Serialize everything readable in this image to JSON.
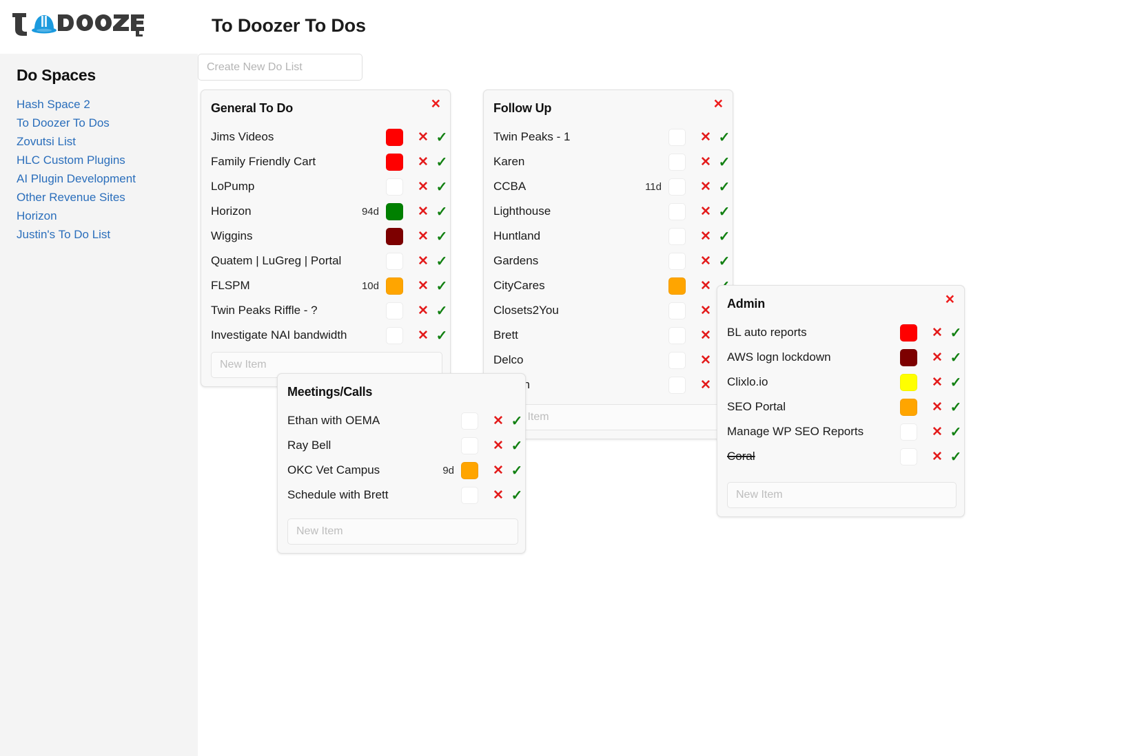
{
  "app": {
    "logo_text": "TO DOOZER",
    "logo_hat_color": "#1b9ade",
    "logo_word_color": "#333333",
    "page_title": "To Doozer To Dos"
  },
  "sidebar": {
    "title": "Do Spaces",
    "items": [
      {
        "label": "Hash Space 2"
      },
      {
        "label": "To Doozer To Dos"
      },
      {
        "label": "Zovutsi List"
      },
      {
        "label": "HLC Custom Plugins"
      },
      {
        "label": "AI Plugin Development"
      },
      {
        "label": "Other Revenue Sites"
      },
      {
        "label": "Horizon"
      },
      {
        "label": "Justin's To Do List"
      }
    ]
  },
  "toolbar": {
    "create_list_placeholder": "Create New Do List",
    "create_list_value": ""
  },
  "icons": {
    "close": "×",
    "delete": "✕",
    "complete": "✓"
  },
  "colors": {
    "red": "#ff0000",
    "dark_red": "#7d0000",
    "green": "#008000",
    "orange": "#ffa500",
    "yellow": "#ffff00",
    "empty": "#ffffff",
    "accent_link": "#2a6ebb",
    "danger": "#e31b1b",
    "success": "#128012"
  },
  "new_item_placeholder": "New Item",
  "cards": [
    {
      "id": "general",
      "title": "General To Do",
      "close_label": "×",
      "new_item_placeholder": "New Item",
      "items": [
        {
          "label": "Jims Videos",
          "days": "",
          "color": "#ff0000",
          "struck": false
        },
        {
          "label": "Family Friendly Cart",
          "days": "",
          "color": "#ff0000",
          "struck": false
        },
        {
          "label": "LoPump",
          "days": "",
          "color": "",
          "struck": false
        },
        {
          "label": "Horizon",
          "days": "94d",
          "color": "#008000",
          "struck": false
        },
        {
          "label": "Wiggins",
          "days": "",
          "color": "#7d0000",
          "struck": false
        },
        {
          "label": "Quatem | LuGreg | Portal",
          "days": "",
          "color": "",
          "struck": false
        },
        {
          "label": "FLSPM",
          "days": "10d",
          "color": "#ffa500",
          "struck": false
        },
        {
          "label": "Twin Peaks Riffle - ?",
          "days": "",
          "color": "",
          "struck": false
        },
        {
          "label": "Investigate NAI bandwidth",
          "days": "",
          "color": "",
          "struck": false
        }
      ]
    },
    {
      "id": "followup",
      "title": "Follow Up",
      "close_label": "×",
      "new_item_placeholder": "New Item",
      "items": [
        {
          "label": "Twin Peaks - 1",
          "days": "",
          "color": "",
          "struck": false
        },
        {
          "label": "Karen",
          "days": "",
          "color": "",
          "struck": false
        },
        {
          "label": "CCBA",
          "days": "11d",
          "color": "",
          "struck": false
        },
        {
          "label": "Lighthouse",
          "days": "",
          "color": "",
          "struck": false
        },
        {
          "label": "Huntland",
          "days": "",
          "color": "",
          "struck": false
        },
        {
          "label": "Gardens",
          "days": "",
          "color": "",
          "struck": false
        },
        {
          "label": "CityCares",
          "days": "",
          "color": "#ffa500",
          "struck": false
        },
        {
          "label": "Closets2You",
          "days": "",
          "color": "",
          "struck": false
        },
        {
          "label": "Brett",
          "days": "",
          "color": "",
          "struck": false
        },
        {
          "label": "Delco",
          "days": "",
          "color": "",
          "struck": false
        },
        {
          "label": "Sexton",
          "days": "",
          "color": "",
          "struck": false
        }
      ]
    },
    {
      "id": "meetings",
      "title": "Meetings/Calls",
      "close_label": "",
      "new_item_placeholder": "New Item",
      "items": [
        {
          "label": "Ethan with OEMA",
          "days": "",
          "color": "",
          "struck": false
        },
        {
          "label": "Ray Bell",
          "days": "",
          "color": "",
          "struck": false
        },
        {
          "label": "OKC Vet Campus",
          "days": "9d",
          "color": "#ffa500",
          "struck": false
        },
        {
          "label": "Schedule with Brett",
          "days": "",
          "color": "",
          "struck": false
        }
      ]
    },
    {
      "id": "admin",
      "title": "Admin",
      "close_label": "×",
      "new_item_placeholder": "New Item",
      "items": [
        {
          "label": "BL auto reports",
          "days": "",
          "color": "#ff0000",
          "struck": false
        },
        {
          "label": "AWS logn lockdown",
          "days": "",
          "color": "#7d0000",
          "struck": false
        },
        {
          "label": "Clixlo.io",
          "days": "",
          "color": "#ffff00",
          "struck": false
        },
        {
          "label": "SEO Portal",
          "days": "",
          "color": "#ffa500",
          "struck": false
        },
        {
          "label": "Manage WP SEO Reports",
          "days": "",
          "color": "",
          "struck": false
        },
        {
          "label": "Coral",
          "days": "",
          "color": "",
          "struck": true
        }
      ]
    }
  ]
}
